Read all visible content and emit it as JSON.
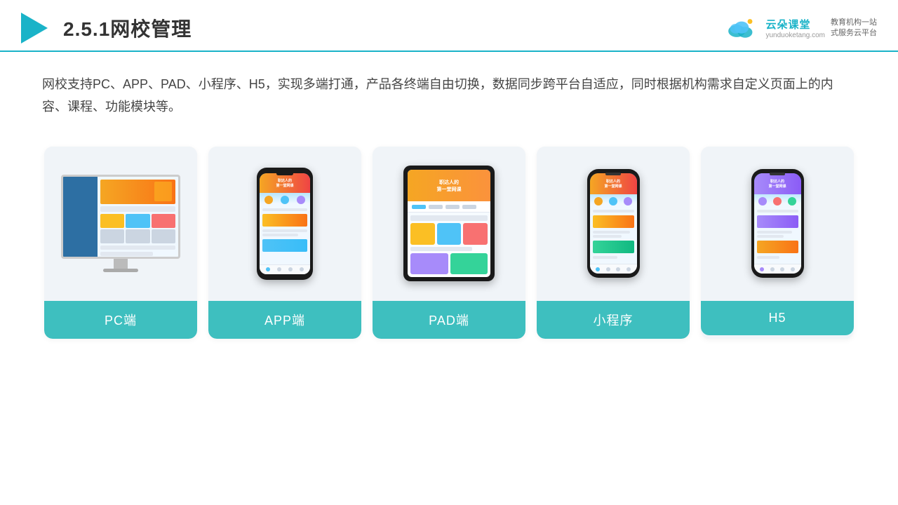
{
  "header": {
    "title": "2.5.1网校管理",
    "logo": {
      "name": "云朵课堂",
      "domain": "yunduoketang.com",
      "slogan": "教育机构一站\n式服务云平台"
    }
  },
  "description": "网校支持PC、APP、PAD、小程序、H5，实现多端打通，产品各终端自由切换，数据同步跨平台自适应，同时根据机构需求自定义页面上的内容、课程、功能模块等。",
  "cards": [
    {
      "id": "pc",
      "label": "PC端"
    },
    {
      "id": "app",
      "label": "APP端"
    },
    {
      "id": "pad",
      "label": "PAD端"
    },
    {
      "id": "miniapp",
      "label": "小程序"
    },
    {
      "id": "h5",
      "label": "H5"
    }
  ],
  "colors": {
    "accent": "#1ab3c8",
    "teal": "#3ebfbf",
    "orange": "#f5a623",
    "dark": "#333333",
    "text": "#444444",
    "bg_card": "#f0f4f8"
  }
}
